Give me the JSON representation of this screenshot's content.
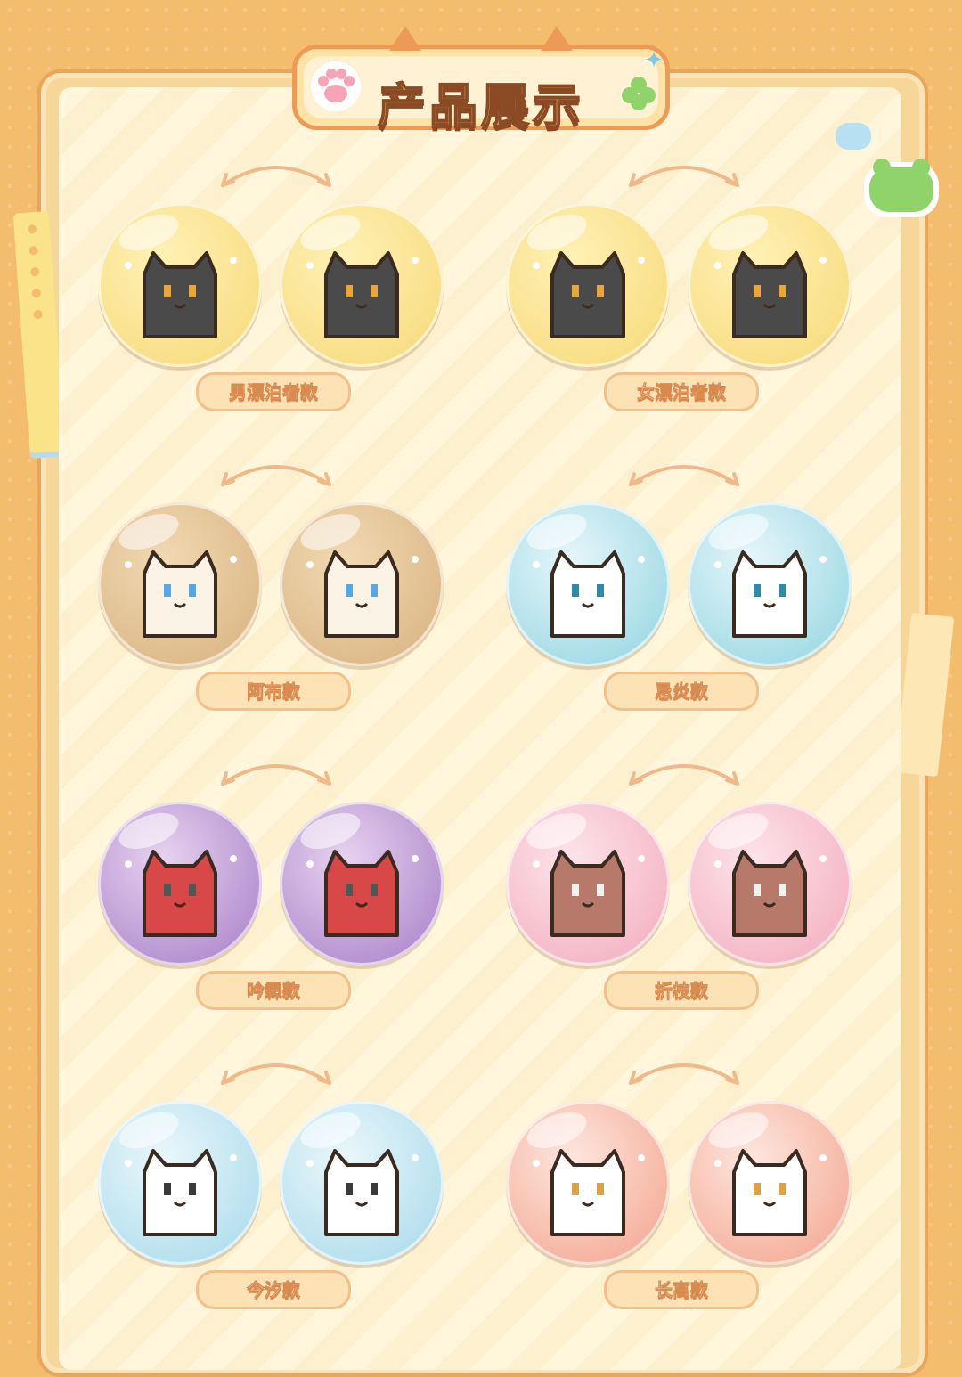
{
  "header": {
    "title": "产品展示"
  },
  "products": [
    {
      "label": "男漂泊者款",
      "bg": [
        "#fff2b6",
        "#f6d775"
      ],
      "char": "#4a4a4a",
      "accent": "#e8a63b"
    },
    {
      "label": "女漂泊者款",
      "bg": [
        "#fff2b6",
        "#f6d775"
      ],
      "char": "#4a4a4a",
      "accent": "#e8a63b"
    },
    {
      "label": "阿布款",
      "bg": [
        "#f1d9b2",
        "#d7b07d"
      ],
      "char": "#fbf3e6",
      "accent": "#5aa7e0"
    },
    {
      "label": "忌炎款",
      "bg": [
        "#e6f6fa",
        "#8fd3e0"
      ],
      "char": "#ffffff",
      "accent": "#2f8aa6"
    },
    {
      "label": "吟霖款",
      "bg": [
        "#e7d2ef",
        "#a57bc6"
      ],
      "char": "#d94848",
      "accent": "#555"
    },
    {
      "label": "折枝款",
      "bg": [
        "#fde3ea",
        "#f2a9bb"
      ],
      "char": "#b77a6a",
      "accent": "#f0f0f0"
    },
    {
      "label": "今汐款",
      "bg": [
        "#eaf7fb",
        "#a4d8ea"
      ],
      "char": "#ffffff",
      "accent": "#3a3a3a"
    },
    {
      "label": "长离款",
      "bg": [
        "#fde6df",
        "#f3a188"
      ],
      "char": "#ffffff",
      "accent": "#d9a24a"
    }
  ]
}
